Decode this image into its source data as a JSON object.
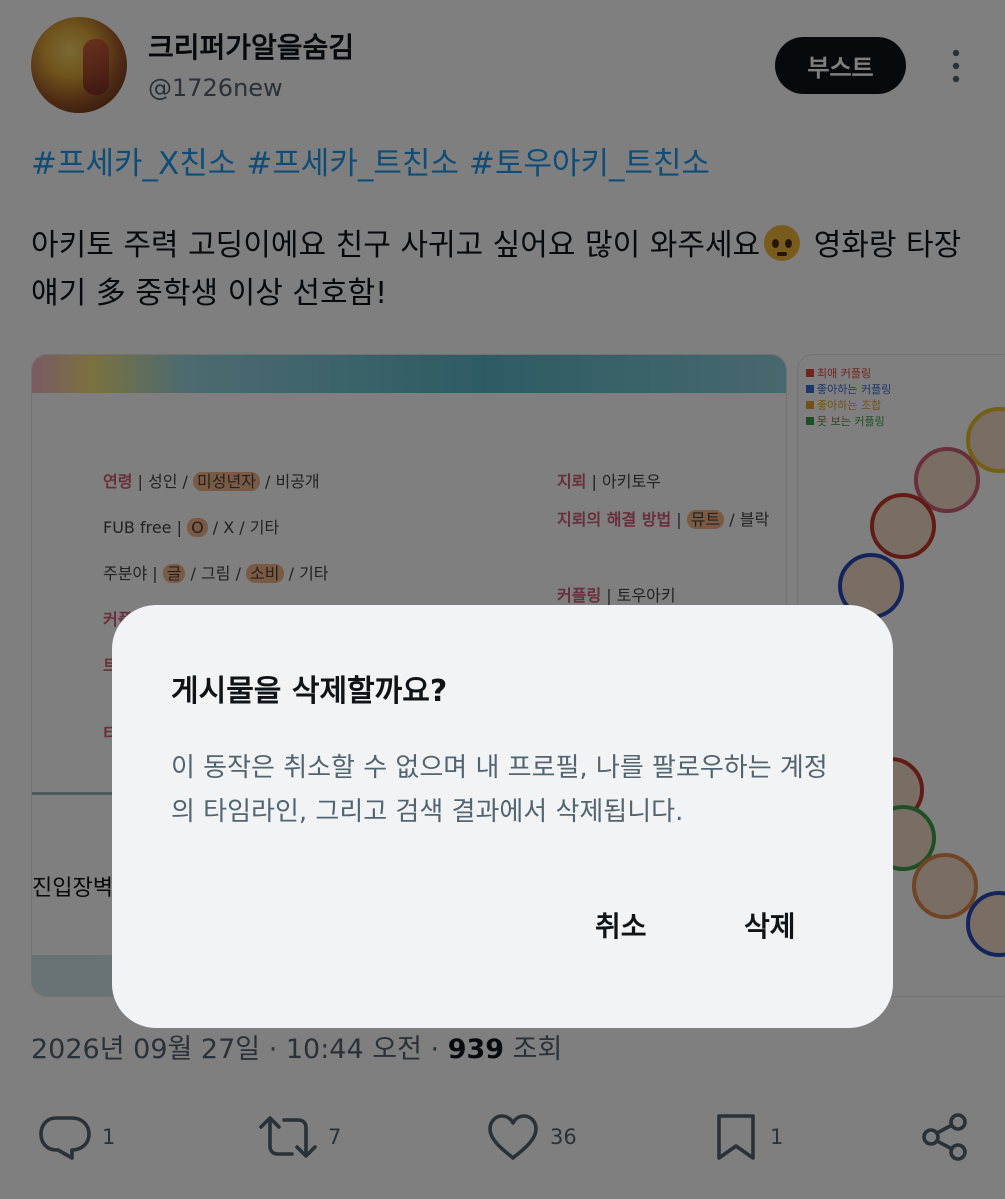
{
  "post": {
    "author": {
      "display_name": "크리퍼가알을숨김",
      "handle": "@1726new"
    },
    "boost_label": "부스트",
    "hashtags": [
      "#프세카_X친소",
      "#프세카_트친소",
      "#토우아키_트친소"
    ],
    "text_line1": "아키토 주력 고딩이에요 친구 사귀고 싶어요 많이 와주세요",
    "text_line1_after": " 영화랑 타장",
    "text_line2": "얘기 多 중학생 이상 선호함!",
    "emoji": "pleading-face"
  },
  "media1": {
    "age_label": "연령",
    "age_opts": [
      "성인",
      "미성년자",
      "비공개"
    ],
    "fub_label": "FUB free",
    "fub_opts": [
      "O",
      "X",
      "기타"
    ],
    "field_label": "주분야",
    "field_opts": [
      "글",
      "그림",
      "소비",
      "기타"
    ],
    "coupling_partial": "커플링",
    "partial_t": "트",
    "partial_e": "티",
    "bias_label": "지뢰",
    "bias_value": "아키토우",
    "solution_label": "지뢰의 해결 방법",
    "solution_opts": [
      "뮤트",
      "블락"
    ],
    "coupling_label": "커플링",
    "coupling_value": "토우아키",
    "side_text": "진입장벽 낮"
  },
  "media2": {
    "legend": [
      {
        "label": "최애 커플링",
        "color": "#e0483f"
      },
      {
        "label": "좋아하는 커플링",
        "color": "#3b6fd6"
      },
      {
        "label": "좋아하는 조합",
        "color": "#e6a23c"
      },
      {
        "label": "못 보는 커플링",
        "color": "#3aa14a"
      }
    ]
  },
  "footer": {
    "date": "2026년 09월 27일 · 10:44 오전 · ",
    "views": "939",
    "views_label": " 조회"
  },
  "actions": {
    "replies": "1",
    "reposts": "7",
    "likes": "36",
    "bookmarks": "1"
  },
  "dialog": {
    "title": "게시물을 삭제할까요?",
    "message": "이 동작은 취소할 수 없으며 내 프로필, 나를 팔로우하는 계정의 타임라인, 그리고 검색 결과에서 삭제됩니다.",
    "cancel_label": "취소",
    "delete_label": "삭제"
  }
}
